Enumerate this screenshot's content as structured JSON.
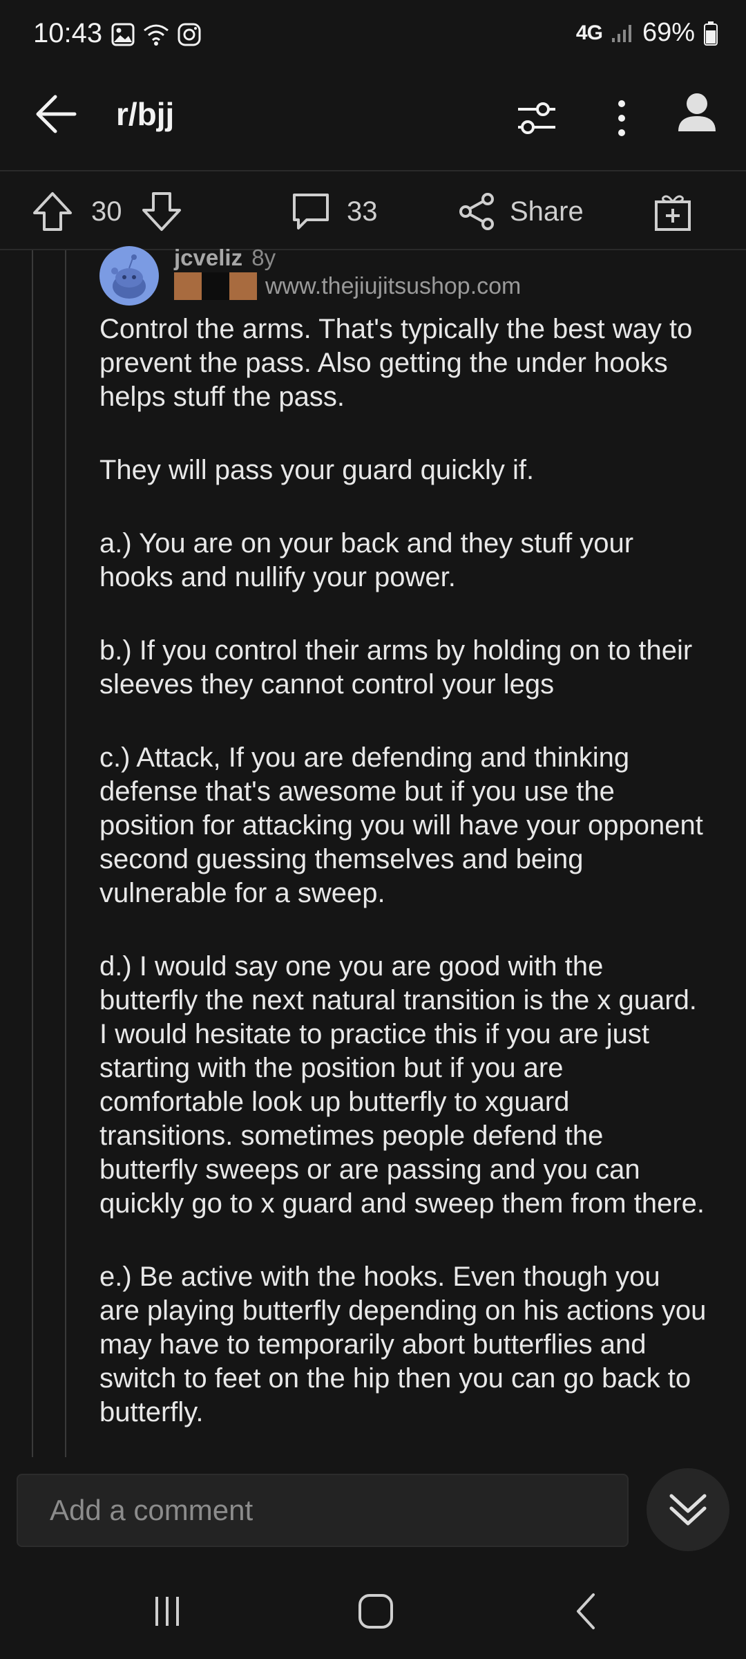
{
  "status": {
    "time": "10:43",
    "network": "4G",
    "battery": "69%",
    "icons": [
      "image-icon",
      "wifi-icon",
      "instagram-icon",
      "signal-icon",
      "battery-icon"
    ]
  },
  "header": {
    "title": "r/bjj",
    "icons": [
      "back-arrow-icon",
      "filter-icon",
      "more-icon",
      "user-icon"
    ]
  },
  "actions": {
    "score": "30",
    "comments": "33",
    "share_label": "Share",
    "icons": [
      "upvote-icon",
      "downvote-icon",
      "comment-icon",
      "share-icon",
      "award-icon"
    ]
  },
  "comment": {
    "username": "jcveliz",
    "age": "8y",
    "flair": "www.thejiujitsushop.com",
    "flair_colors": [
      "#a86b3f",
      "#0d0d0d",
      "#a86b3f"
    ],
    "paragraphs": [
      "Control the arms.  That's typically the best way to prevent the pass.  Also getting the under hooks helps stuff the pass.",
      "They will pass your guard quickly if.",
      "a.) You are on your back and they stuff your hooks and nullify your power.",
      "b.) If you control their arms by holding on to their sleeves they cannot control your legs",
      "c.) Attack,  If you are defending and thinking defense that's awesome but if you use the position for attacking you will have your opponent second guessing themselves and being vulnerable for a sweep.",
      "d.) I would say one you are good with the butterfly the next natural transition is the x guard.  I would hesitate to practice this if you are just starting with the position but if you are comfortable look up butterfly to xguard transitions.  sometimes people defend the butterfly sweeps or are passing and you can quickly go to x guard and sweep them from there.",
      "e.) Be active with the hooks.  Even though you are playing butterfly depending on his actions you may have to temporarily abort butterflies and switch to feet on the hip then you can go back to butterfly."
    ]
  },
  "composer": {
    "placeholder": "Add a comment"
  },
  "colors": {
    "background": "#151515",
    "text": "#e8e8e8",
    "muted": "#9a9a9a",
    "avatar": "#7b9be3"
  }
}
